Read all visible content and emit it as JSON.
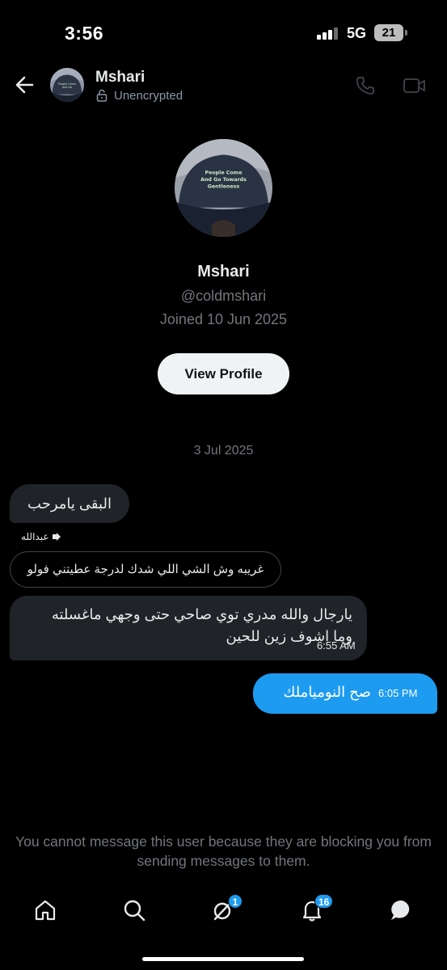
{
  "status_bar": {
    "time": "3:56",
    "network": "5G",
    "battery": "21"
  },
  "header": {
    "name": "Mshari",
    "encryption": "Unencrypted"
  },
  "profile": {
    "name": "Mshari",
    "handle": "@coldmshari",
    "joined": "Joined 10 Jun 2025",
    "view_profile_label": "View Profile"
  },
  "conversation": {
    "date": "3 Jul 2025",
    "messages": [
      {
        "direction": "incoming",
        "text": "البقى يامرحب"
      },
      {
        "direction": "incoming",
        "reply_to_name": "عبدالله",
        "reply_quote": "غريبه وش الشي اللي شدك لدرجة عطيتني فولو",
        "line1": "يارجال والله مدري توي صاحي حتى وجهي ماغسلته",
        "line2": "وما اشوف زين للحين",
        "time": "6:55 AM"
      },
      {
        "direction": "outgoing",
        "text": "صح النومياملك",
        "time": "6:05 PM"
      }
    ],
    "blocked_notice": "You cannot message this user because they are blocking you from sending messages to them."
  },
  "bottom_nav": {
    "items": [
      {
        "name": "home"
      },
      {
        "name": "search"
      },
      {
        "name": "grok",
        "badge": "1"
      },
      {
        "name": "notifications",
        "badge": "16"
      },
      {
        "name": "messages"
      }
    ]
  },
  "colors": {
    "background": "#000000",
    "incoming_bubble": "#202327",
    "outgoing_bubble": "#1d9bf0",
    "muted_text": "#71767b",
    "badge": "#1d9bf0"
  }
}
